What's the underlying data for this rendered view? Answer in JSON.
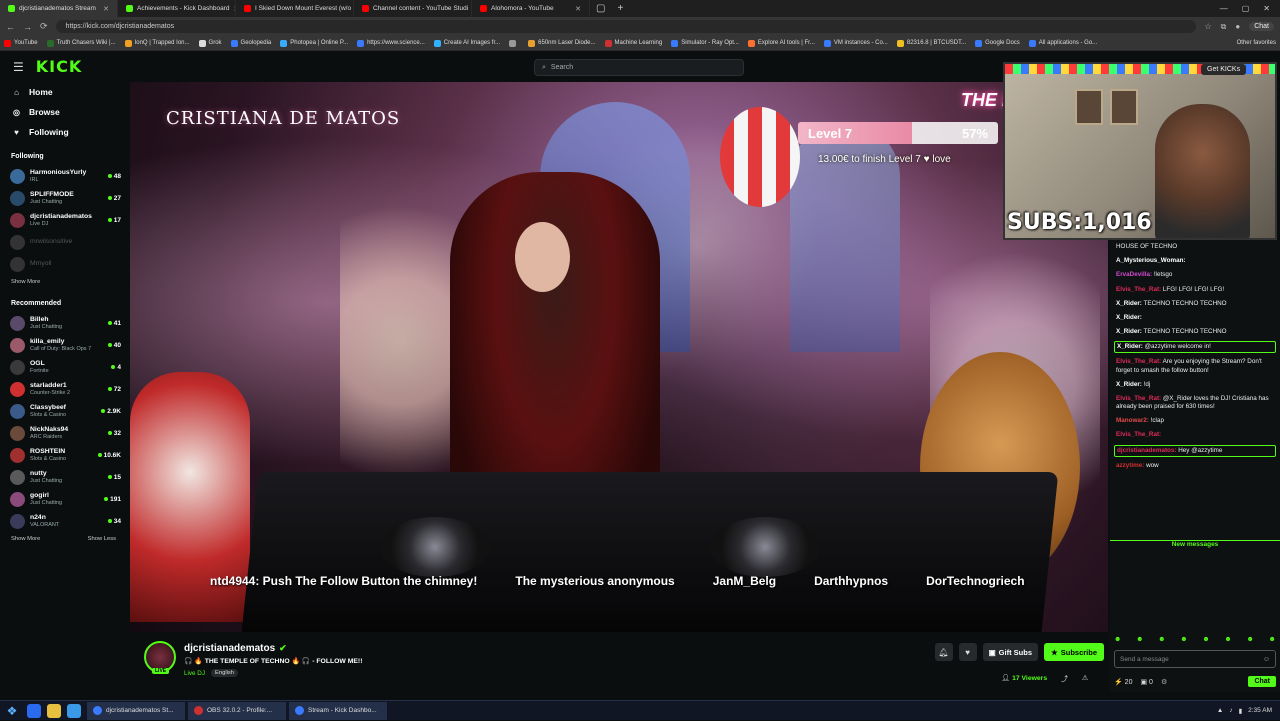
{
  "browser": {
    "tabs": [
      {
        "label": "djcristianadematos Stream",
        "color": "#53fc18",
        "active": true
      },
      {
        "label": "Achievements - Kick Dashboard",
        "color": "#53fc18"
      },
      {
        "label": "I Skied Down Mount Everest (w/o",
        "color": "#ff0000"
      },
      {
        "label": "Channel content - YouTube Studi",
        "color": "#ff0000"
      },
      {
        "label": "Alohomora - YouTube",
        "color": "#ff0000"
      }
    ],
    "url": "https://kick.com/djcristianadematos",
    "chat_button": "Chat",
    "bookmarks": [
      {
        "label": "YouTube",
        "color": "#ff0000"
      },
      {
        "label": "Truth Chasers Wiki |...",
        "color": "#2a6a2a"
      },
      {
        "label": "IonQ | Trapped Ion...",
        "color": "#f0a020"
      },
      {
        "label": "Grok",
        "color": "#dddddd"
      },
      {
        "label": "Geolopedia",
        "color": "#3a7aff"
      },
      {
        "label": "Photopea | Online P...",
        "color": "#3aaaff"
      },
      {
        "label": "https://www.science...",
        "color": "#3a7aff"
      },
      {
        "label": "Create AI Images fr...",
        "color": "#30b0ff"
      },
      {
        "label": "",
        "color": "#999999"
      },
      {
        "label": "650nm Laser Diode...",
        "color": "#e8a030"
      },
      {
        "label": "Machine Learning",
        "color": "#d03030"
      },
      {
        "label": "Simulator - Ray Opt...",
        "color": "#3a7aff"
      },
      {
        "label": "Explore AI tools | Fr...",
        "color": "#ff7030"
      },
      {
        "label": "VM instances - Co...",
        "color": "#3a7aff"
      },
      {
        "label": "82316.8 | BTCUSDT...",
        "color": "#f0c020"
      },
      {
        "label": "Google Docs",
        "color": "#3a7aff"
      },
      {
        "label": "All applications - Go...",
        "color": "#3a7aff"
      }
    ],
    "other_favorites": "Other favorites"
  },
  "kick": {
    "logo": "KICK",
    "search_placeholder": "Search",
    "nav": [
      {
        "label": "Home",
        "icon": "home-icon"
      },
      {
        "label": "Browse",
        "icon": "compass-icon"
      },
      {
        "label": "Following",
        "icon": "heart-icon"
      }
    ],
    "following_title": "Following",
    "following": [
      {
        "name": "HarmoniousYurly",
        "category": "IRL",
        "viewers": "48",
        "avatar": "#3a6a9a"
      },
      {
        "name": "SPLIFFMODE",
        "category": "Just Chatting",
        "viewers": "27",
        "avatar": "#2a4a6a"
      },
      {
        "name": "djcristianadematos",
        "category": "Live DJ",
        "viewers": "17",
        "avatar": "#7a3040"
      },
      {
        "name": "mrwilsonsitive",
        "category": "",
        "viewers": "",
        "avatar": "#333333",
        "offline": true
      },
      {
        "name": "Mmyoll",
        "category": "",
        "viewers": "",
        "avatar": "#333333",
        "offline": true
      }
    ],
    "show_more": "Show More",
    "recommended_title": "Recommended",
    "recommended": [
      {
        "name": "Billeh",
        "category": "Just Chatting",
        "viewers": "41",
        "avatar": "#5a4a6a"
      },
      {
        "name": "killa_emily",
        "category": "Call of Duty: Black Ops 7",
        "viewers": "40",
        "avatar": "#9a5a6a"
      },
      {
        "name": "OGL",
        "category": "Fortnite",
        "viewers": "4",
        "avatar": "#3a3a3a"
      },
      {
        "name": "starladder1",
        "category": "Counter-Strike 2",
        "viewers": "72",
        "avatar": "#d03030"
      },
      {
        "name": "Classybeef",
        "category": "Slots & Casino",
        "viewers": "2.9K",
        "avatar": "#3a5a8a"
      },
      {
        "name": "NickNaks94",
        "category": "ARC Raiders",
        "viewers": "32",
        "avatar": "#6a4a3a"
      },
      {
        "name": "ROSHTEIN",
        "category": "Slots & Casino",
        "viewers": "10.6K",
        "avatar": "#a03030"
      },
      {
        "name": "nutty",
        "category": "Just Chatting",
        "viewers": "15",
        "avatar": "#5a5a5a"
      },
      {
        "name": "gogirl",
        "category": "Just Chatting",
        "viewers": "191",
        "avatar": "#8a4a7a"
      },
      {
        "name": "n24n",
        "category": "VALORANT",
        "viewers": "34",
        "avatar": "#3a3a5a"
      }
    ],
    "show_more_2": "Show More",
    "show_less": "Show Less"
  },
  "stream": {
    "overlay_title": "CRISTIANA DE MATOS",
    "love_chain": "THE LOVE CHAI",
    "level": "Level 7",
    "level_pct": "57%",
    "level_fill": 0.57,
    "level_sub": "13.00€ to finish Level 7 ♥ love",
    "ticker": [
      "ntd4944: Push The Follow Button the chimney!",
      "The mysterious anonymous",
      "JanM_Belg",
      "Darthhypnos",
      "DorTechnogriech"
    ],
    "webcam_subs": "SUBS:1,016",
    "get_kicks": "Get KICKs"
  },
  "chat": {
    "messages": [
      {
        "user": "",
        "text": "HOUSE OF TECHNO",
        "ucolor": "#ffffff"
      },
      {
        "user": "A_Mysterious_Woman:",
        "text": "",
        "ucolor": "#ffffff"
      },
      {
        "user": "ErvaDevilla:",
        "text": "!letsgo",
        "ucolor": "#d04ad0"
      },
      {
        "user": "Elvis_The_Rat:",
        "text": "LFG! LFG! LFG! LFG!",
        "ucolor": "#e02a5a"
      },
      {
        "user": "X_Rider:",
        "text": "TECHNO TECHNO TECHNO",
        "ucolor": "#ffffff"
      },
      {
        "user": "X_Rider:",
        "text": "",
        "ucolor": "#ffffff"
      },
      {
        "user": "X_Rider:",
        "text": "TECHNO TECHNO TECHNO",
        "ucolor": "#ffffff"
      },
      {
        "user": "X_Rider:",
        "text": "@azzytime welcome in!",
        "ucolor": "#ffffff",
        "hl": true
      },
      {
        "user": "Elvis_The_Rat:",
        "text": "Are you enjoying the Stream? Don't forget to smash the follow button!",
        "ucolor": "#e02a5a"
      },
      {
        "user": "X_Rider:",
        "text": "!dj",
        "ucolor": "#ffffff"
      },
      {
        "user": "Elvis_The_Rat:",
        "text": "@X_Rider loves the DJ! Cristiana has already been praised for 630 times!",
        "ucolor": "#e02a5a"
      },
      {
        "user": "Manowar2:",
        "text": "!clap",
        "ucolor": "#e04a4a"
      },
      {
        "user": "Elvis_The_Rat:",
        "text": "",
        "ucolor": "#e02a5a"
      },
      {
        "user": "djcristianadematos:",
        "text": "Hey @azzytime",
        "ucolor": "#e02a5a",
        "hl": true
      },
      {
        "user": "azzytime:",
        "text": "wow",
        "ucolor": "#d03030"
      }
    ],
    "new_messages": "New messages",
    "placeholder": "Send a message",
    "kick_count": "20",
    "gift_count": "0",
    "send_label": "Chat"
  },
  "channel": {
    "name": "djcristianadematos",
    "title": "🎧 🔥 THE TEMPLE OF TECHNO 🔥 🎧 - FOLLOW ME!!",
    "category": "Live DJ",
    "language": "English",
    "live": "LIVE",
    "gift_subs": "Gift Subs",
    "subscribe": "Subscribe",
    "viewers": "17 Viewers"
  },
  "taskbar": {
    "apps": [
      {
        "label": "djcristianadematos St...",
        "color": "#3a7aff"
      },
      {
        "label": "OBS 32.0.2 - Profile:...",
        "color": "#d03030"
      },
      {
        "label": "Stream - Kick Dashbo...",
        "color": "#3a7aff"
      }
    ],
    "time": "2:35 AM"
  }
}
